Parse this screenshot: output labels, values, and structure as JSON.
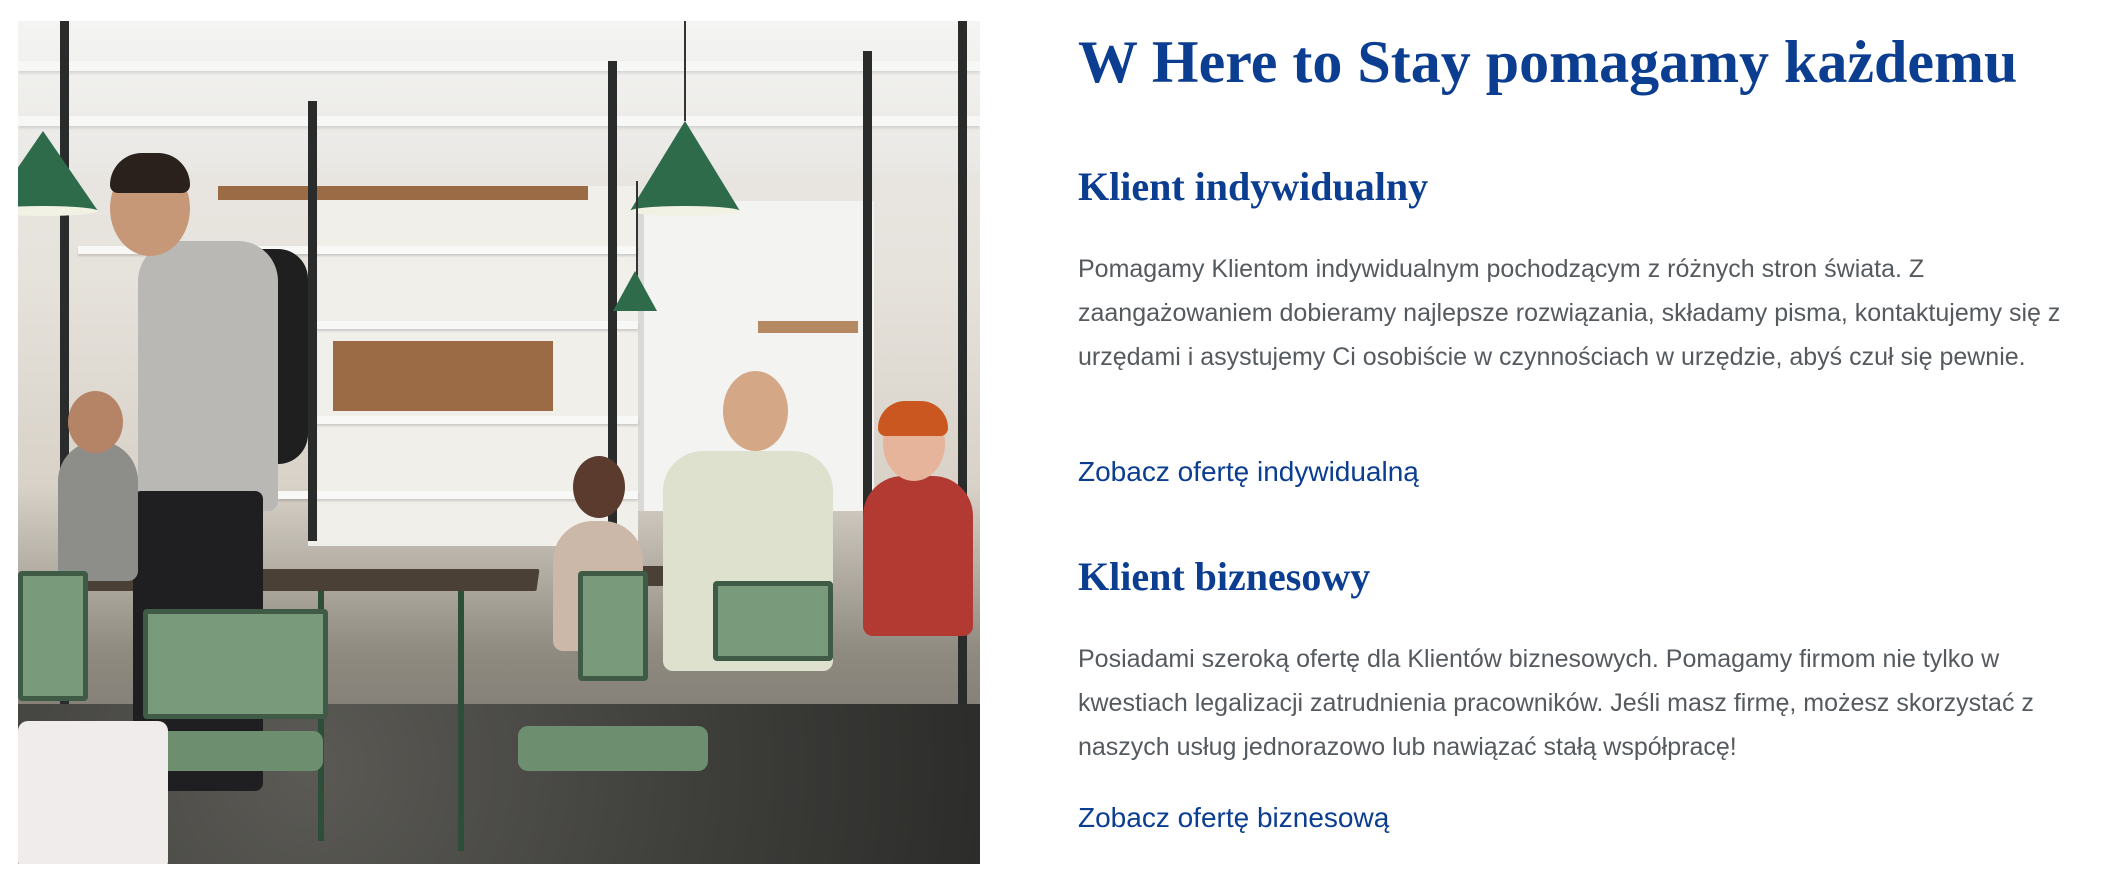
{
  "photo": {
    "alt_subject": "cafe-interior"
  },
  "headline": "W Here to Stay pomagamy każdemu",
  "sections": [
    {
      "title": "Klient indywidualny",
      "text": "Pomagamy Klientom indywidualnym pochodzącym z różnych stron świata. Z zaangażowaniem dobieramy najlepsze rozwiązania, składamy pisma, kontaktujemy się z urzędami i asystujemy Ci osobiście w czynnościach w urzędzie, abyś czuł się pewnie.",
      "link": "Zobacz ofertę indywidualną"
    },
    {
      "title": "Klient biznesowy",
      "text": "Posiadami szeroką ofertę dla Klientów biznesowych. Pomagamy firmom nie tylko w kwestiach legalizacji zatrudnienia pracowników. Jeśli masz firmę, możesz skorzystać z naszych usług jednorazowo lub nawiązać stałą współpracę!",
      "link": "Zobacz ofertę biznesową"
    }
  ],
  "colors": {
    "heading": "#0b3d91",
    "body_text": "#555a5f",
    "link": "#0b3d91",
    "background": "#ffffff"
  }
}
